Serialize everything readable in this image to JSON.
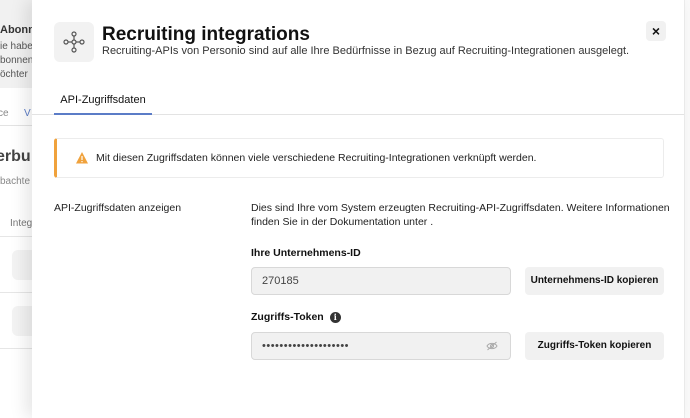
{
  "background": {
    "banner_lines": [
      "Abonne",
      "ie habe",
      "bonnen",
      "öchter"
    ],
    "tabs": [
      "ce",
      "V"
    ],
    "heading": "erbu",
    "subtext": "bachte",
    "column_header": "Integ"
  },
  "header": {
    "title": "Recruiting integrations",
    "subtitle": "Recruiting-APIs von Personio sind auf alle Ihre Bedürfnisse in Bezug auf Recruiting-Integrationen ausgelegt.",
    "close_label": "×"
  },
  "tabs": [
    {
      "label": "API-Zugriffsdaten",
      "active": true
    }
  ],
  "warning": {
    "text": "Mit diesen Zugriffsdaten können viele verschiedene Recruiting-Integrationen verknüpft werden.",
    "accent_color": "#f0a23c"
  },
  "credentials": {
    "section_label": "API-Zugriffsdaten anzeigen",
    "description": "Dies sind Ihre vom System erzeugten Recruiting-API-Zugriffsdaten. Weitere Informationen finden Sie in der Dokumentation unter .",
    "company_id": {
      "label": "Ihre Unternehmens-ID",
      "value": "270185",
      "copy_button": "Unternehmens-ID kopieren"
    },
    "token": {
      "label": "Zugriffs-Token",
      "info_icon": "i",
      "value": "••••••••••••••••••••",
      "copy_button": "Zugriffs-Token kopieren"
    }
  },
  "colors": {
    "tab_underline": "#5b7cc7",
    "button_bg": "#f1f1f1"
  }
}
